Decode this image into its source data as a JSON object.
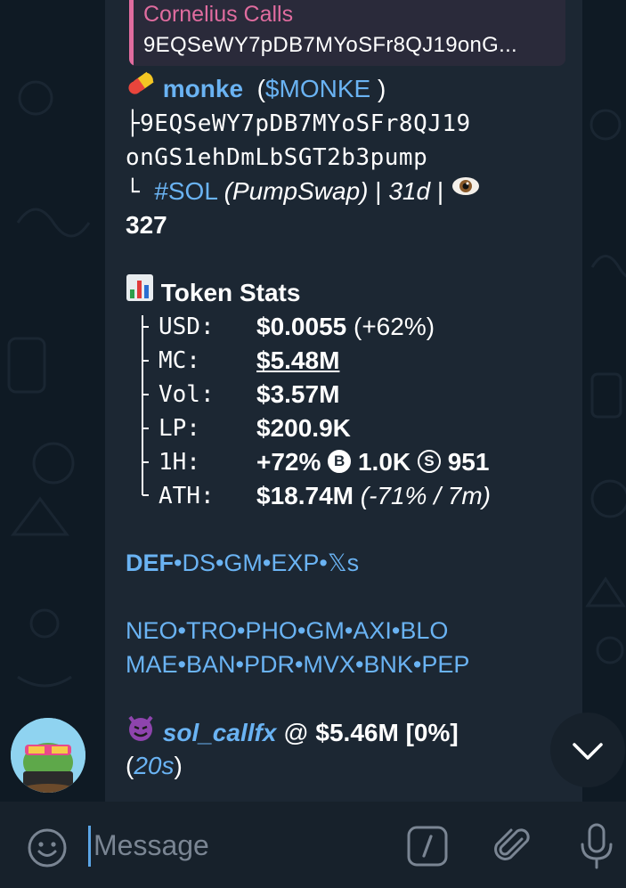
{
  "reply": {
    "author": "Cornelius Calls",
    "text": "9EQSeWY7pDB7MYoSFr8QJ19onG..."
  },
  "token": {
    "name": "monke",
    "ticker_open": "(",
    "ticker": "$MONKE",
    "ticker_close": " )",
    "address_line1": "9EQSeWY7pDB7MYoSFr8QJ19",
    "address_line2": "onGS1ehDmLbSGT2b3pump",
    "chain_tag": "#SOL",
    "dex": "(PumpSwap)",
    "sep1": " | ",
    "age": "31d",
    "sep2": " | ",
    "views": "327"
  },
  "stats": {
    "heading": "Token Stats",
    "rows": [
      {
        "label": "USD:",
        "value": "$0.0055",
        "extra": " (+62%)"
      },
      {
        "label": "MC:",
        "value": "$5.48M"
      },
      {
        "label": "Vol:",
        "value": "$3.57M"
      },
      {
        "label": "LP:",
        "value": "$200.9K"
      },
      {
        "label": "1H:",
        "value": "+72%",
        "buy_badge": "B",
        "buys": "1.0K",
        "sell_badge": "S",
        "sells": "951"
      },
      {
        "label": "ATH:",
        "value": "$18.74M",
        "extra": "(-71% / 7m)"
      }
    ]
  },
  "links_row1": [
    "DEF",
    "DS",
    "GM",
    "EXP",
    "𝕏s"
  ],
  "links_row2": [
    "NEO",
    "TRO",
    "PHO",
    "GM",
    "AXI",
    "BLO"
  ],
  "links_row3": [
    "MAE",
    "BAN",
    "PDR",
    "MVX",
    "BNK",
    "PEP"
  ],
  "caller": {
    "name": "sol_callfx",
    "at": " @ ",
    "mc": "$5.46M [0%]",
    "time_open": "(",
    "time": "20s",
    "time_close": ")"
  },
  "input": {
    "placeholder": "Message"
  },
  "icons": {
    "emoji": "smiley-icon",
    "commands": "slash-command-icon",
    "attach": "paperclip-icon",
    "mic": "microphone-icon",
    "scroll": "chevron-down-icon"
  },
  "colors": {
    "link": "#6ab3f3",
    "reply_accent": "#e06c9f",
    "bubble": "#1c2733",
    "background": "#0e1621"
  }
}
